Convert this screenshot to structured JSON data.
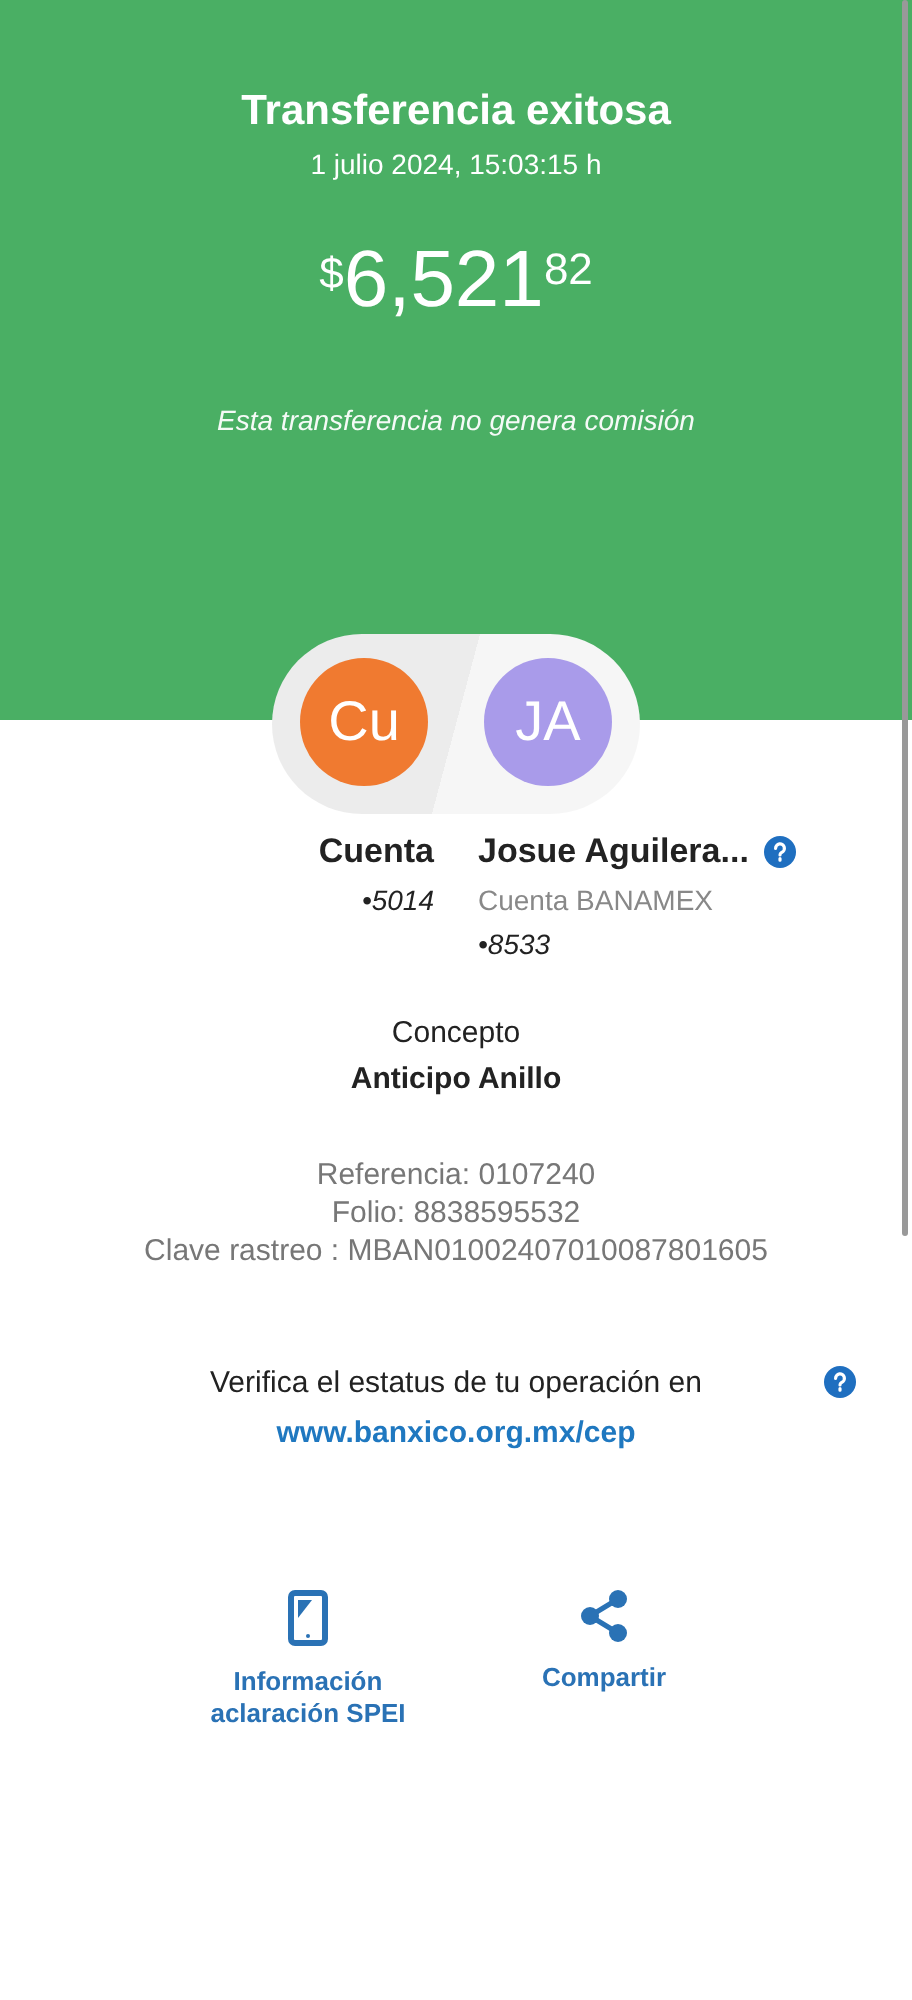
{
  "header": {
    "title": "Transferencia exitosa",
    "datetime": "1 julio 2024, 15:03:15 h",
    "amount": {
      "currency": "$",
      "whole": "6,521",
      "cents": "82"
    },
    "note": "Esta transferencia no genera comisión"
  },
  "parties": [
    {
      "initials": "Cu",
      "color": "#f07a30",
      "name": "Cuenta",
      "account": "•5014"
    },
    {
      "initials": "JA",
      "color": "#a99bea",
      "name": "Josue Aguilera...",
      "lines": [
        "Cuenta BANAMEX"
      ],
      "account": "•8533",
      "help": true
    }
  ],
  "concept": {
    "label": "Concepto",
    "value": "Anticipo Anillo"
  },
  "details": [
    "Referencia: 0107240",
    "Folio: 8838595532",
    "Clave rastreo : MBAN01002407010087801605"
  ],
  "verify": {
    "text": "Verifica el estatus de tu operación en",
    "link": "www.banxico.org.mx/cep"
  },
  "actions": [
    {
      "kind": "tablet",
      "label": "Información aclaración SPEI"
    },
    {
      "kind": "share",
      "label": "Compartir"
    }
  ]
}
